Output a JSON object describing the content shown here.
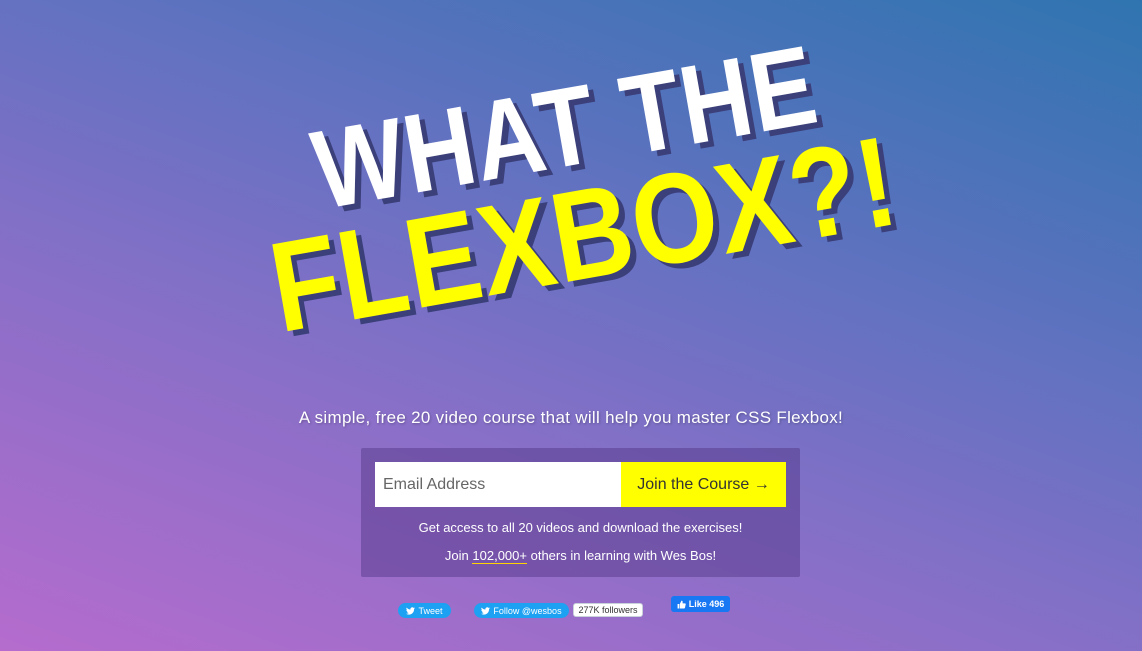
{
  "hero": {
    "line1": "WHAT THE",
    "line2": "FLEXBOX?!"
  },
  "subtitle": "A simple, free 20 video course that will help you master CSS Flexbox!",
  "signup": {
    "email_placeholder": "Email Address",
    "join_label": "Join the Course →",
    "access_text": "Get access to all 20 videos and download the exercises!",
    "join_prefix": "Join ",
    "join_count": "102,000+",
    "join_suffix": " others in learning with Wes Bos!"
  },
  "social": {
    "tweet_label": "Tweet",
    "follow_label": "Follow @wesbos",
    "followers_label": "277K followers",
    "like_label": "Like 496"
  },
  "colors": {
    "accent_yellow": "#ffff00",
    "twitter_blue": "#1da1f2",
    "facebook_blue": "#1877f2"
  },
  "icons": {
    "tweet": "twitter-bird-icon",
    "follow": "twitter-bird-icon",
    "like": "thumbs-up-icon"
  }
}
